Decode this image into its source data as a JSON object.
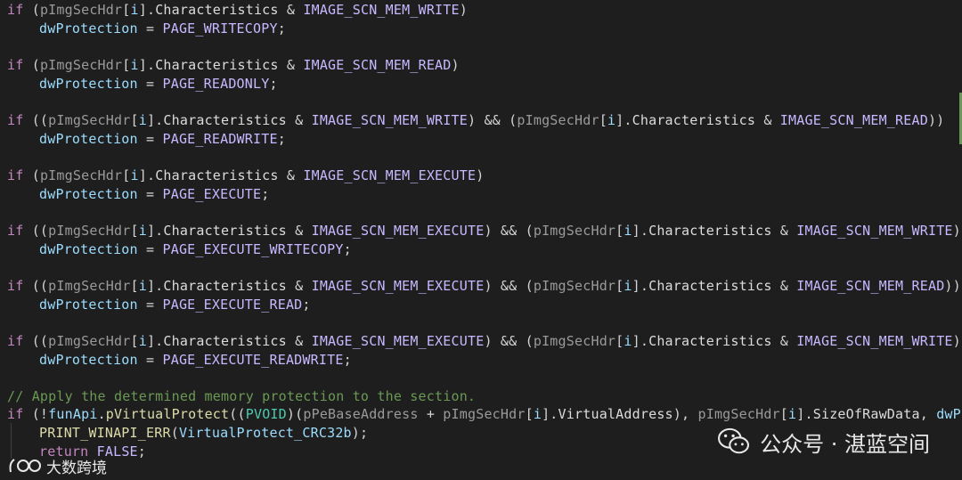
{
  "code": {
    "lines": [
      {
        "kw": "if",
        "pre": " (",
        "var": "pImgSecHdr",
        "idx": "i",
        "mem": "Characteristics",
        "const": "IMAGE_SCN_MEM_WRITE",
        "post": ")"
      },
      {
        "var": "dwProtection",
        "const": "PAGE_WRITECOPY"
      },
      {
        "kw": "if",
        "pre": " (",
        "var": "pImgSecHdr",
        "idx": "i",
        "mem": "Characteristics",
        "const": "IMAGE_SCN_MEM_READ",
        "post": ")"
      },
      {
        "var": "dwProtection",
        "const": "PAGE_READONLY"
      },
      {
        "kw": "if",
        "var1": "pImgSecHdr",
        "idx1": "i",
        "mem1": "Characteristics",
        "const1": "IMAGE_SCN_MEM_WRITE",
        "var2": "pImgSecHdr",
        "idx2": "i",
        "mem2": "Characteristics",
        "const2": "IMAGE_SCN_MEM_READ",
        "tail": "))"
      },
      {
        "var": "dwProtection",
        "const": "PAGE_READWRITE"
      },
      {
        "kw": "if",
        "pre": " (",
        "var": "pImgSecHdr",
        "idx": "i",
        "mem": "Characteristics",
        "const": "IMAGE_SCN_MEM_EXECUTE",
        "post": ")"
      },
      {
        "var": "dwProtection",
        "const": "PAGE_EXECUTE"
      },
      {
        "kw": "if",
        "var1": "pImgSecHdr",
        "idx1": "i",
        "mem1": "Characteristics",
        "const1": "IMAGE_SCN_MEM_EXECUTE",
        "var2": "pImgSecHdr",
        "idx2": "i",
        "mem2": "Characteristics",
        "const2": "IMAGE_SCN_MEM_WRITE",
        "tail": ")"
      },
      {
        "var": "dwProtection",
        "const": "PAGE_EXECUTE_WRITECOPY"
      },
      {
        "kw": "if",
        "var1": "pImgSecHdr",
        "idx1": "i",
        "mem1": "Characteristics",
        "const1": "IMAGE_SCN_MEM_EXECUTE",
        "var2": "pImgSecHdr",
        "idx2": "i",
        "mem2": "Characteristics",
        "const2": "IMAGE_SCN_MEM_READ",
        "tail": "))"
      },
      {
        "var": "dwProtection",
        "const": "PAGE_EXECUTE_READ"
      },
      {
        "kw": "if",
        "var1": "pImgSecHdr",
        "idx1": "i",
        "mem1": "Characteristics",
        "const1": "IMAGE_SCN_MEM_EXECUTE",
        "var2": "pImgSecHdr",
        "idx2": "i",
        "mem2": "Characteristics",
        "const2": "IMAGE_SCN_MEM_WRITE",
        "tail": ")"
      },
      {
        "var": "dwProtection",
        "const": "PAGE_EXECUTE_READWRITE"
      }
    ],
    "comment": "// Apply the determined memory protection to the section.",
    "call": {
      "kw": "if",
      "pre": " (!",
      "obj": "funApi",
      "fn": "pVirtualProtect",
      "type": "PVOID",
      "arg1": "pPeBaseAddress",
      "var": "pImgSecHdr",
      "idx": "i",
      "mem": "VirtualAddress",
      "mem2": "SizeOfRawData",
      "tailvar": "dwP"
    },
    "err": {
      "fn": "PRINT_WINAPI_ERR",
      "arg": "VirtualProtect_CRC32b"
    },
    "ret": {
      "kw": "return",
      "val": "FALSE"
    }
  },
  "watermark": {
    "text": "公众号 · 湛蓝空间",
    "icon": "wechat-icon"
  },
  "logo2": {
    "text": "大数跨境"
  },
  "colors": {
    "bg": "#1e1e1e",
    "keyword": "#c586c0",
    "variable": "#9cdcfe",
    "constant": "#c8b8ff",
    "function": "#dcdcaa",
    "type": "#4ec9b0",
    "comment": "#6a9955"
  }
}
